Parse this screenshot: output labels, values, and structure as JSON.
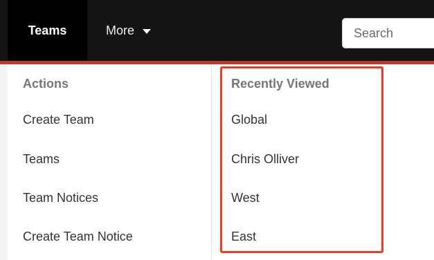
{
  "nav": {
    "teams_label": "Teams",
    "more_label": "More",
    "search_placeholder": "Search"
  },
  "menu": {
    "actions": {
      "heading": "Actions",
      "items": [
        "Create Team",
        "Teams",
        "Team Notices",
        "Create Team Notice"
      ]
    },
    "recently_viewed": {
      "heading": "Recently Viewed",
      "items": [
        "Global",
        "Chris Olliver",
        "West",
        "East"
      ]
    }
  },
  "colors": {
    "topbar": "#141414",
    "active_tab": "#000000",
    "highlight_outline": "#ee3c23"
  }
}
